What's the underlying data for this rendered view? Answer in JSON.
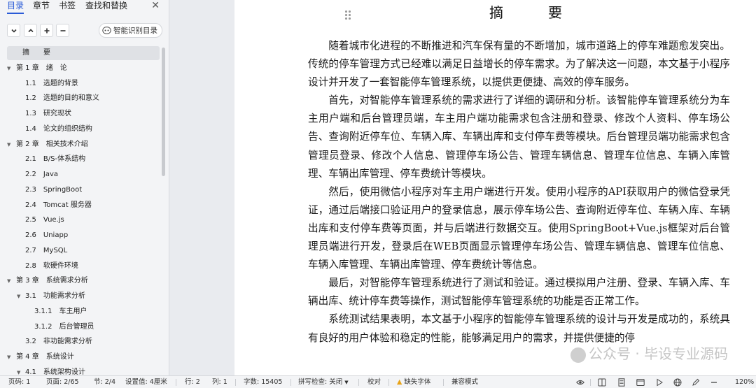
{
  "nav": {
    "tabs": [
      {
        "label": "目录",
        "active": true
      },
      {
        "label": "章节"
      },
      {
        "label": "书签"
      },
      {
        "label": "查找和替换"
      }
    ],
    "close_glyph": "✕",
    "smart_button_label": "智能识别目录",
    "toc": [
      {
        "label": "摘　　要",
        "level": 1,
        "selected": true
      },
      {
        "label": "第 1 章　绪　论",
        "level": 1,
        "expanded": true
      },
      {
        "label": "1.1　选题的背景",
        "level": 2
      },
      {
        "label": "1.2　选题的目的和意义",
        "level": 2
      },
      {
        "label": "1.3　研究现状",
        "level": 2
      },
      {
        "label": "1.4　论文的组织结构",
        "level": 2
      },
      {
        "label": "第 2 章　相关技术介绍",
        "level": 1,
        "expanded": true
      },
      {
        "label": "2.1　B/S-体系结构",
        "level": 2
      },
      {
        "label": "2.2　Java",
        "level": 2
      },
      {
        "label": "2.3　SpringBoot",
        "level": 2
      },
      {
        "label": "2.4　Tomcat 服务器",
        "level": 2
      },
      {
        "label": "2.5　Vue.js",
        "level": 2
      },
      {
        "label": "2.6　Uniapp",
        "level": 2
      },
      {
        "label": "2.7　MySQL",
        "level": 2
      },
      {
        "label": "2.8　软硬件环境",
        "level": 2
      },
      {
        "label": "第 3 章　系统需求分析",
        "level": 1,
        "expanded": true
      },
      {
        "label": "3.1　功能需求分析",
        "level": 2,
        "expanded": true
      },
      {
        "label": "3.1.1　车主用户",
        "level": 3
      },
      {
        "label": "3.1.2　后台管理员",
        "level": 3
      },
      {
        "label": "3.2　非功能需求分析",
        "level": 2
      },
      {
        "label": "第 4 章　系统设计",
        "level": 1,
        "expanded": true
      },
      {
        "label": "4.1　系统架构设计",
        "level": 2,
        "expanded": true
      }
    ]
  },
  "document": {
    "title": "摘　要",
    "paragraphs": [
      "随着城市化进程的不断推进和汽车保有量的不断增加，城市道路上的停车难题愈发突出。传统的停车管理方式已经难以满足日益增长的停车需求。为了解决这一问题，本文基于小程序设计并开发了一套智能停车管理系统，以提供更便捷、高效的停车服务。",
      "首先，对智能停车管理系统的需求进行了详细的调研和分析。该智能停车管理系统分为车主用户端和后台管理员端，车主用户端功能需求包含注册和登录、修改个人资料、停车场公告、查询附近停车位、车辆入库、车辆出库和支付停车费等模块。后台管理员端功能需求包含管理员登录、修改个人信息、管理停车场公告、管理车辆信息、管理车位信息、车辆入库管理、车辆出库管理、停车费统计等模块。",
      "然后，使用微信小程序对车主用户端进行开发。使用小程序的API获取用户的微信登录凭证，通过后端接口验证用户的登录信息，展示停车场公告、查询附近停车位、车辆入库、车辆出库和支付停车费等页面，并与后端进行数据交互。使用SpringBoot+Vue.js框架对后台管理员端进行开发，登录后在WEB页面显示管理停车场公告、管理车辆信息、管理车位信息、车辆入库管理、车辆出库管理、停车费统计等信息。",
      "最后，对智能停车管理系统进行了测试和验证。通过模拟用户注册、登录、车辆入库、车辆出库、统计停车费等操作，测试智能停车管理系统的功能是否正常工作。",
      "系统测试结果表明，本文基于小程序的智能停车管理系统的设计与开发是成功的，系统具有良好的用户体验和稳定的性能，能够满足用户的需求，并提供便捷的停"
    ],
    "watermark": "公众号 · 毕设专业源码"
  },
  "statusbar": {
    "page_code": "页码: 1",
    "page": "页面: 2/65",
    "section": "节: 2/4",
    "setting": "设置值: 4厘米",
    "row": "行: 2",
    "col": "列: 1",
    "words": "字数: 15405",
    "spellcheck": "拼写检查: 关闭",
    "proofread": "校对",
    "missing_font": "缺失字体",
    "compat": "兼容模式",
    "zoom": "120%"
  },
  "colors": {
    "accent": "#2a5bd7",
    "warning": "#e8a317"
  }
}
